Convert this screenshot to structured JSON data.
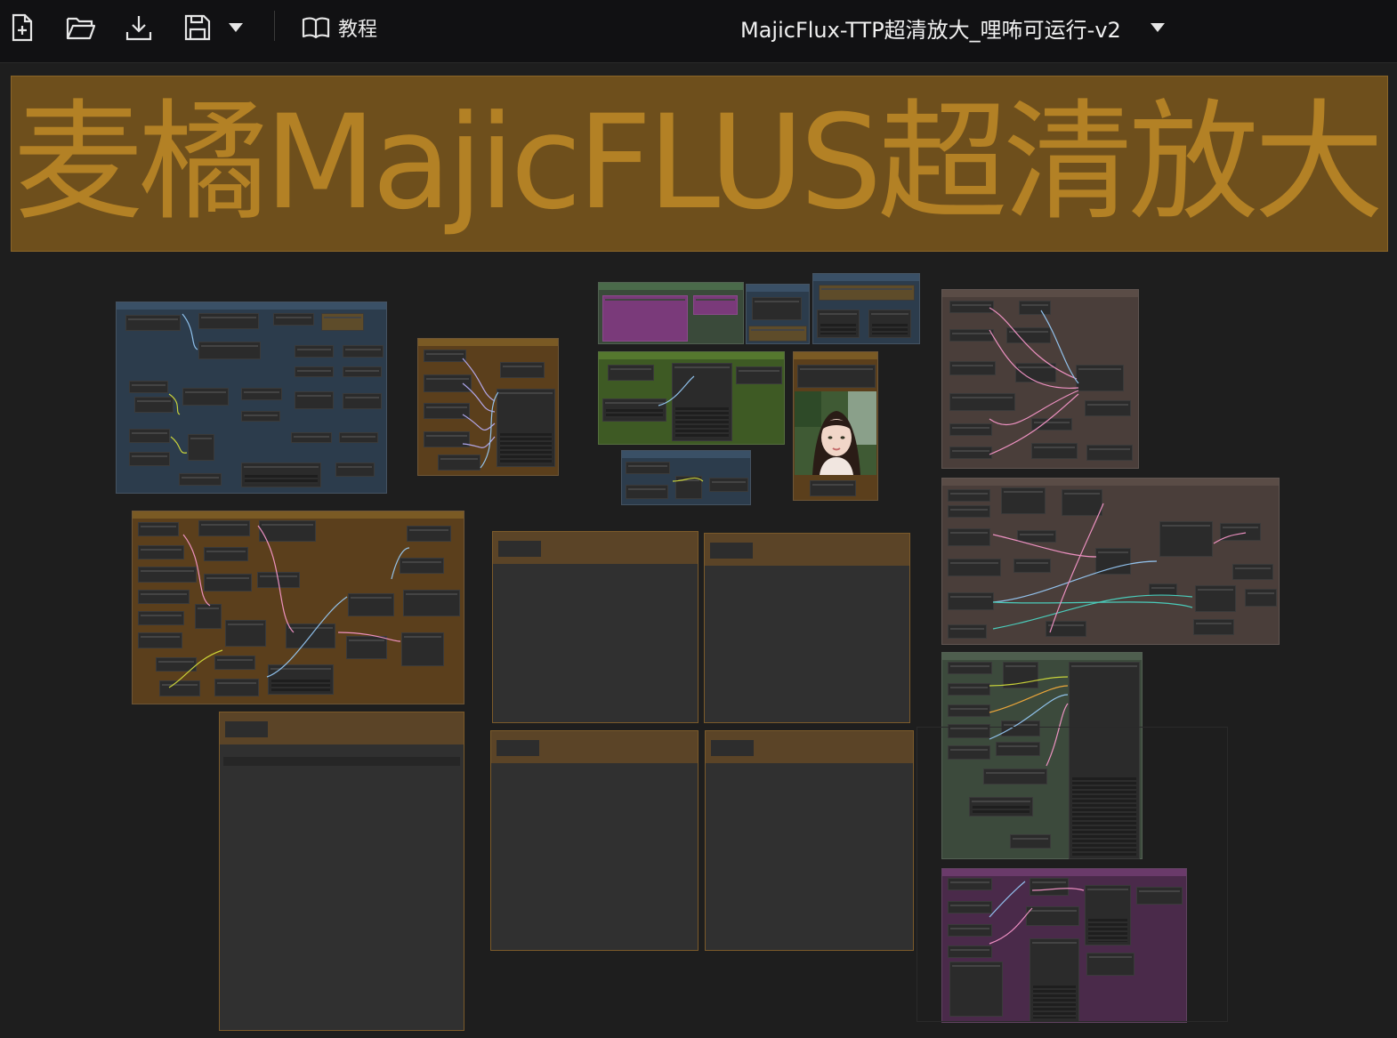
{
  "toolbar": {
    "tutorial_label": "教程",
    "workflow_title": "MajicFlux-TTP超清放大_哩咘可运行-v2"
  },
  "banner": {
    "text": "麦橘MajicFLUS超清放大"
  },
  "colors": {
    "toolbar_bg": "#111113",
    "canvas_bg": "#1e1e1e",
    "banner_bg": "#6e4f1c",
    "banner_text": "#b38125",
    "group_blue": "#2c3c4c",
    "group_orange": "#5b3f1c",
    "group_green_dark": "#3a4a3a",
    "group_green": "#3e5a24",
    "group_brown": "#4a3e3a",
    "group_purple": "#4a2a4a"
  },
  "icons": {
    "new": "file-plus-icon",
    "open": "folder-open-icon",
    "export": "download-icon",
    "save": "save-icon",
    "save_menu": "caret-down-icon",
    "tutorial": "book-icon",
    "workflow_menu": "caret-down-icon"
  }
}
